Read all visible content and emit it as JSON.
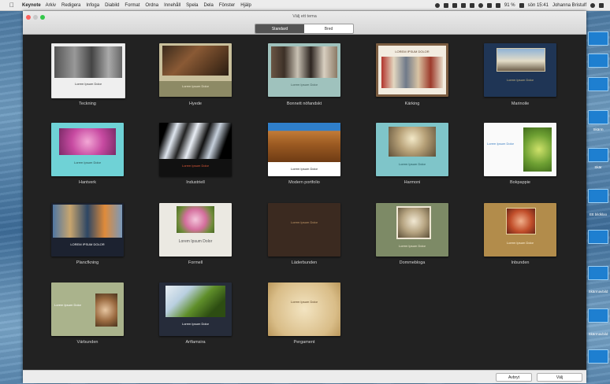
{
  "menubar": {
    "app": "Keynote",
    "items": [
      "Arkiv",
      "Redigera",
      "Infoga",
      "Diabild",
      "Format",
      "Ordna",
      "Innehåll",
      "Spela",
      "Dela",
      "Fönster",
      "Hjälp"
    ],
    "battery": "91 %",
    "clock": "sön 15:41",
    "user": "Johanna Bristulf"
  },
  "window": {
    "title": "Välj ett tema",
    "tabs": [
      {
        "label": "Standard",
        "selected": true
      },
      {
        "label": "Bred",
        "selected": false
      }
    ],
    "cancel_label": "Avbryt",
    "choose_label": "Välj"
  },
  "desktop_labels": [
    "Skärm",
    "Skär",
    "Ett bildkloo",
    "Skärmavbild",
    "Skärmavbild"
  ],
  "templates": [
    {
      "name": "Teckning",
      "text": "Lorem Ipsum Dolor"
    },
    {
      "name": "Hyede",
      "text": "Lorem Ipsum Dolor"
    },
    {
      "name": "Bonnett nöfandskt",
      "text": "Lorem Ipsum Dolor"
    },
    {
      "name": "Kärking",
      "text": "LOREM IPSUM DOLOR"
    },
    {
      "name": "Marinoile",
      "text": "Lorem Ipsum Dolor"
    },
    {
      "name": "Hantverk",
      "text": "Lorem Ipsum Dolor"
    },
    {
      "name": "Industriell",
      "text": "Lorem Ipsum Dolor"
    },
    {
      "name": "Modern portfolio",
      "text": "Lorem Ipsum Dolor"
    },
    {
      "name": "Harmoni",
      "text": "Lorem Ipsum Dolor"
    },
    {
      "name": "Bokpappie",
      "text": "Lorem Ipsum Dolor"
    },
    {
      "name": "Plancfkning",
      "text": "LOREM IPSUM DOLOR"
    },
    {
      "name": "Formell",
      "text": "Lorem Ipsum Dolor"
    },
    {
      "name": "Läderbunden",
      "text": "Lorem Ipsum Dolor"
    },
    {
      "name": "Dommebloga",
      "text": "Lorem Ipsum Dolor"
    },
    {
      "name": "Inbunden",
      "text": "Lorem Ipsum Dolor"
    },
    {
      "name": "Värbunden",
      "text": "Lorem Ipsum Dolor"
    },
    {
      "name": "Artfamsira",
      "text": "Lorem Ipsum Dolor"
    },
    {
      "name": "Pergament",
      "text": "Lorem Ipsum Dolor"
    }
  ],
  "colors": {
    "grid_bg": "#222222",
    "titlebar": "#e4e4e4",
    "close": "#fc605c",
    "minimize": "#fdbc40",
    "zoom": "#34c84a"
  }
}
